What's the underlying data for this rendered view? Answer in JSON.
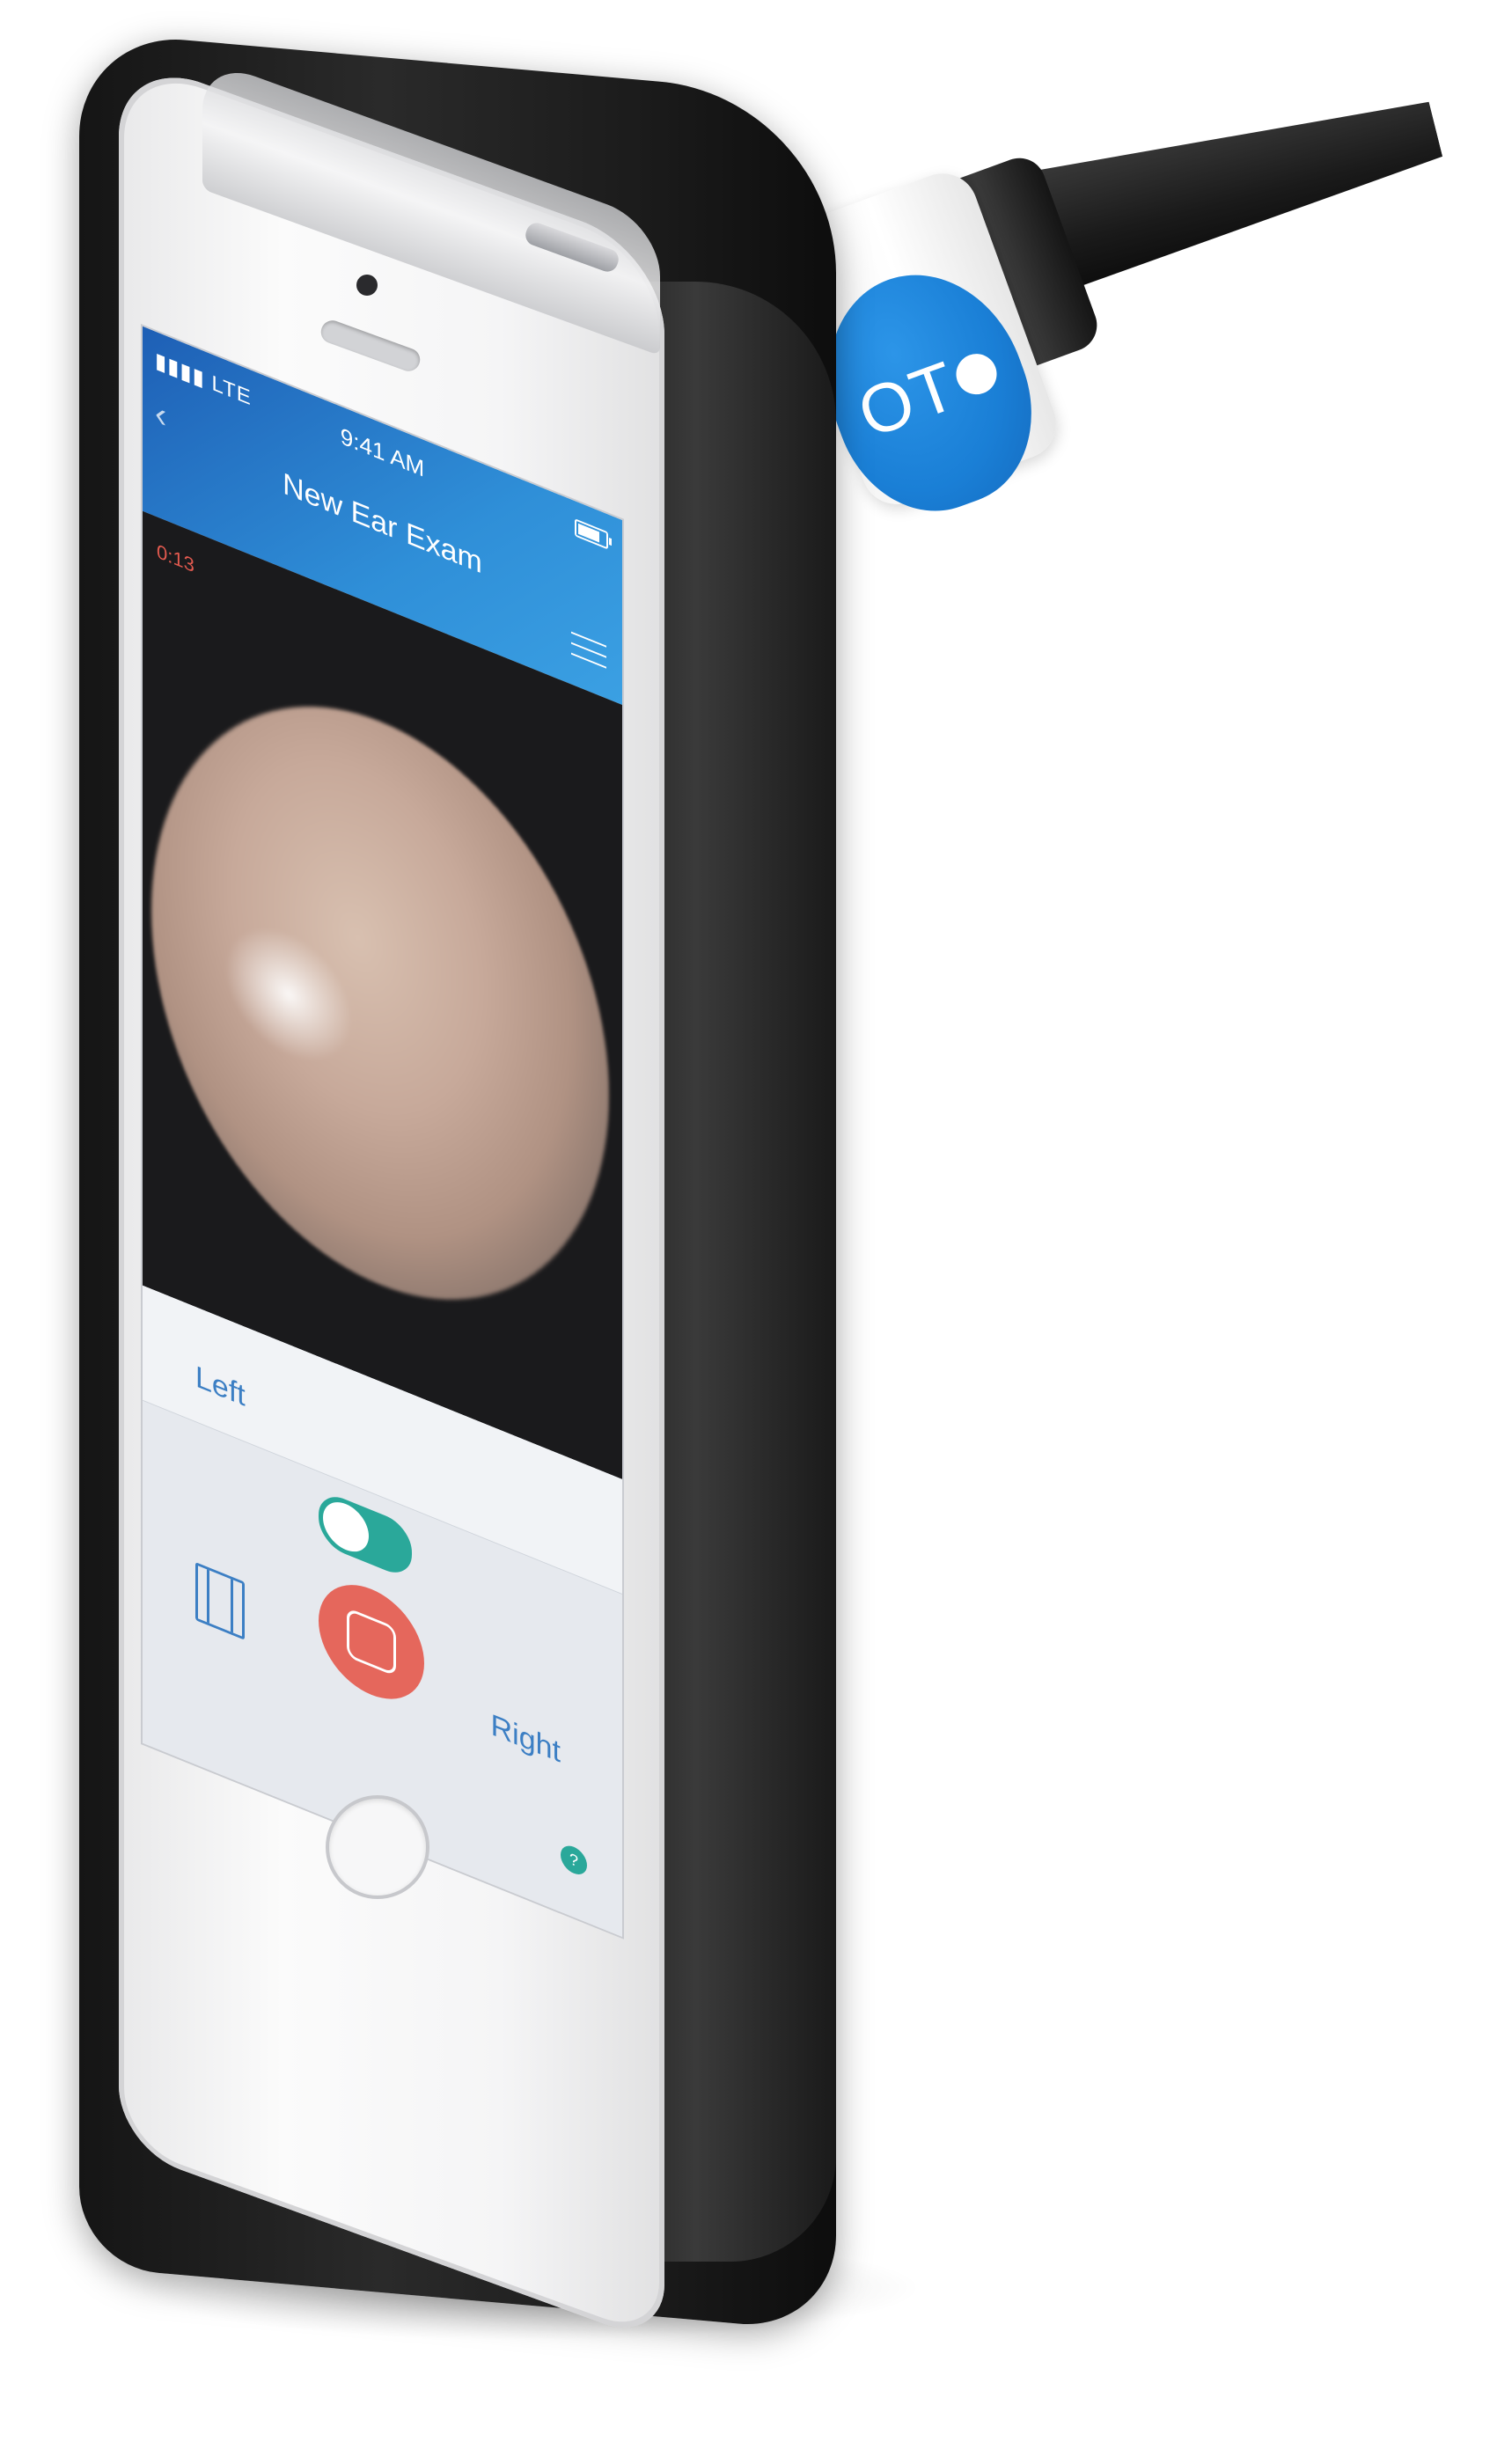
{
  "status_bar": {
    "signal": "▮▮▮▮ LTE",
    "time": "9:41 AM",
    "battery_level": 0.8
  },
  "nav": {
    "back_icon": "chevron-left",
    "title": "New Ear Exam",
    "menu_icon": "hamburger-menu"
  },
  "video": {
    "timer": "0:13"
  },
  "controls": {
    "left_label": "Left",
    "right_label": "Right",
    "toggle_on": true,
    "gallery_icon": "film-icon",
    "record_icon": "stop-record",
    "help_label": "?"
  },
  "device": {
    "brand_text": "OT",
    "brand_color": "#1a7fd6"
  },
  "colors": {
    "nav_blue": "#2f8fd8",
    "accent_teal": "#2aa89a",
    "record_red": "#e5675c",
    "link_blue": "#3c7fc4"
  }
}
